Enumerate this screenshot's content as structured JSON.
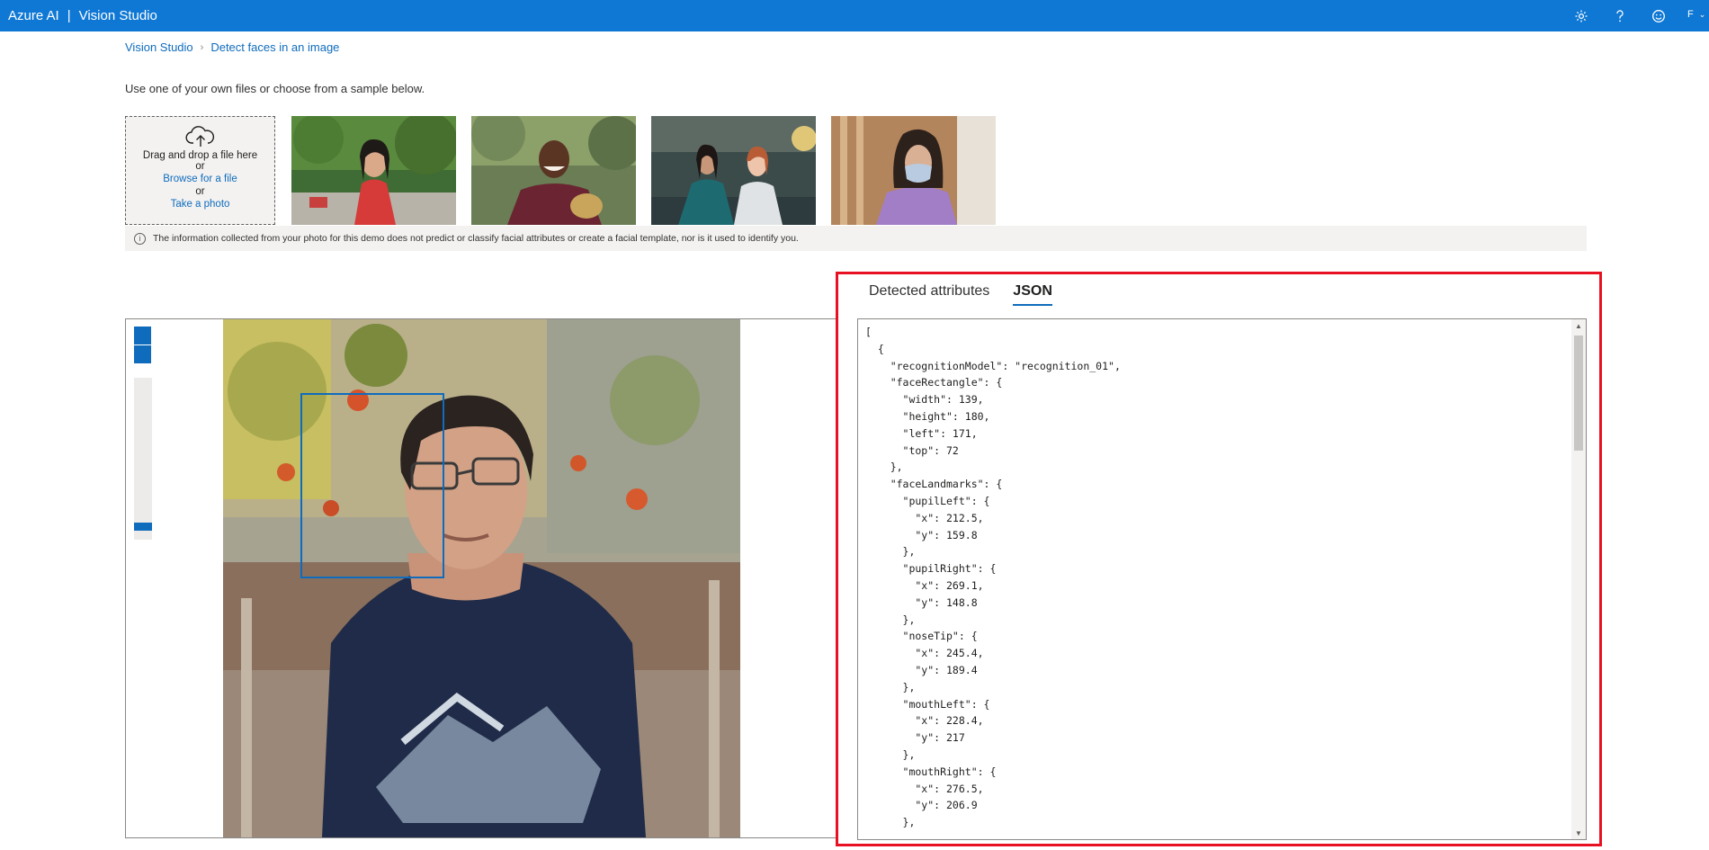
{
  "header": {
    "brand_left": "Azure AI",
    "brand_separator": "|",
    "brand_right": "Vision Studio",
    "icons": [
      "gear-icon",
      "help-icon",
      "feedback-smiley-icon"
    ],
    "user_initial": "F"
  },
  "breadcrumb": {
    "items": [
      "Vision Studio",
      "Detect faces in an image"
    ],
    "separator": ">"
  },
  "intro_text": "Use one of your own files or choose from a sample below.",
  "upload": {
    "drag_text": "Drag and drop a file here",
    "or_text": "or",
    "browse_link": "Browse for a file",
    "photo_link": "Take a photo"
  },
  "samples": [
    {
      "name": "sample-woman-red-dress"
    },
    {
      "name": "sample-man-smiling"
    },
    {
      "name": "sample-two-women-office"
    },
    {
      "name": "sample-woman-mask"
    }
  ],
  "info_text": "The information collected from your photo for this demo does not predict or classify facial attributes or create a facial template, nor is it used to identify you.",
  "result": {
    "tabs": [
      {
        "label": "Detected attributes",
        "active": false
      },
      {
        "label": "JSON",
        "active": true
      }
    ],
    "json_lines": [
      "[",
      "  {",
      "    \"recognitionModel\": \"recognition_01\",",
      "    \"faceRectangle\": {",
      "      \"width\": 139,",
      "      \"height\": 180,",
      "      \"left\": 171,",
      "      \"top\": 72",
      "    },",
      "    \"faceLandmarks\": {",
      "      \"pupilLeft\": {",
      "        \"x\": 212.5,",
      "        \"y\": 159.8",
      "      },",
      "      \"pupilRight\": {",
      "        \"x\": 269.1,",
      "        \"y\": 148.8",
      "      },",
      "      \"noseTip\": {",
      "        \"x\": 245.4,",
      "        \"y\": 189.4",
      "      },",
      "      \"mouthLeft\": {",
      "        \"x\": 228.4,",
      "        \"y\": 217",
      "      },",
      "      \"mouthRight\": {",
      "        \"x\": 276.5,",
      "        \"y\": 206.9",
      "      },"
    ]
  },
  "colors": {
    "accent": "#0f78d4",
    "link": "#0f6cbd",
    "highlight_border": "#e81123"
  }
}
